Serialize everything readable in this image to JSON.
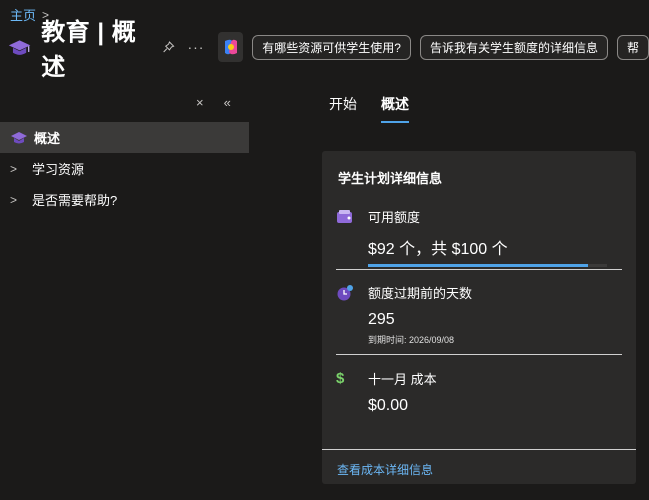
{
  "breadcrumb": {
    "home": "主页"
  },
  "header": {
    "title": "教育 | 概述",
    "chips": [
      "有哪些资源可供学生使用?",
      "告诉我有关学生额度的详细信息",
      "帮"
    ]
  },
  "sidebar": {
    "items": [
      {
        "label": "概述",
        "selected": true
      },
      {
        "label": "学习资源"
      },
      {
        "label": "是否需要帮助?"
      }
    ]
  },
  "tabs": [
    {
      "label": "开始"
    },
    {
      "label": "概述",
      "active": true
    }
  ],
  "card": {
    "title": "学生计划详细信息",
    "credit": {
      "label": "可用额度",
      "value": "$92 个，共 $100 个",
      "progress_fraction": 0.92
    },
    "days": {
      "label": "额度过期前的天数",
      "value": "295",
      "sub": "到期时间: 2026/09/08"
    },
    "cost": {
      "label": "十一月 成本",
      "value": "$0.00"
    },
    "link": "查看成本详细信息"
  },
  "colors": {
    "accent": "#4fa3e8",
    "link": "#6cb8f6",
    "background": "#1b1a19",
    "card": "#2b2a29"
  }
}
